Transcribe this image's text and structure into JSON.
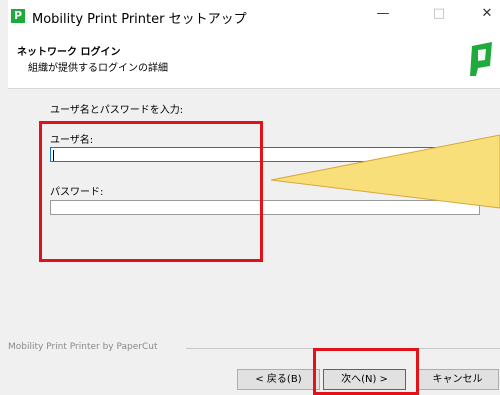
{
  "window": {
    "title": "Mobility Print Printer セットアップ",
    "icon_letter": "P",
    "minimize_label": "—",
    "maximize_label": "□",
    "close_label": "✕"
  },
  "header": {
    "title": "ネットワーク ログイン",
    "subtitle": "組織が提供するログインの詳細",
    "logo_color": "#1faa3c"
  },
  "form": {
    "instruction": "ユーザ名とパスワードを入力:",
    "username_label": "ユーザ名:",
    "username_value": "",
    "password_label": "パスワード:",
    "password_value": ""
  },
  "footer": {
    "brand_text": "Mobility Print Printer by PaperCut"
  },
  "buttons": {
    "back": "< 戻る(B)",
    "next": "次へ(N) >",
    "cancel": "キャンセル"
  },
  "annotation_color": "#e0131a",
  "callout_color": "#f8df7a"
}
